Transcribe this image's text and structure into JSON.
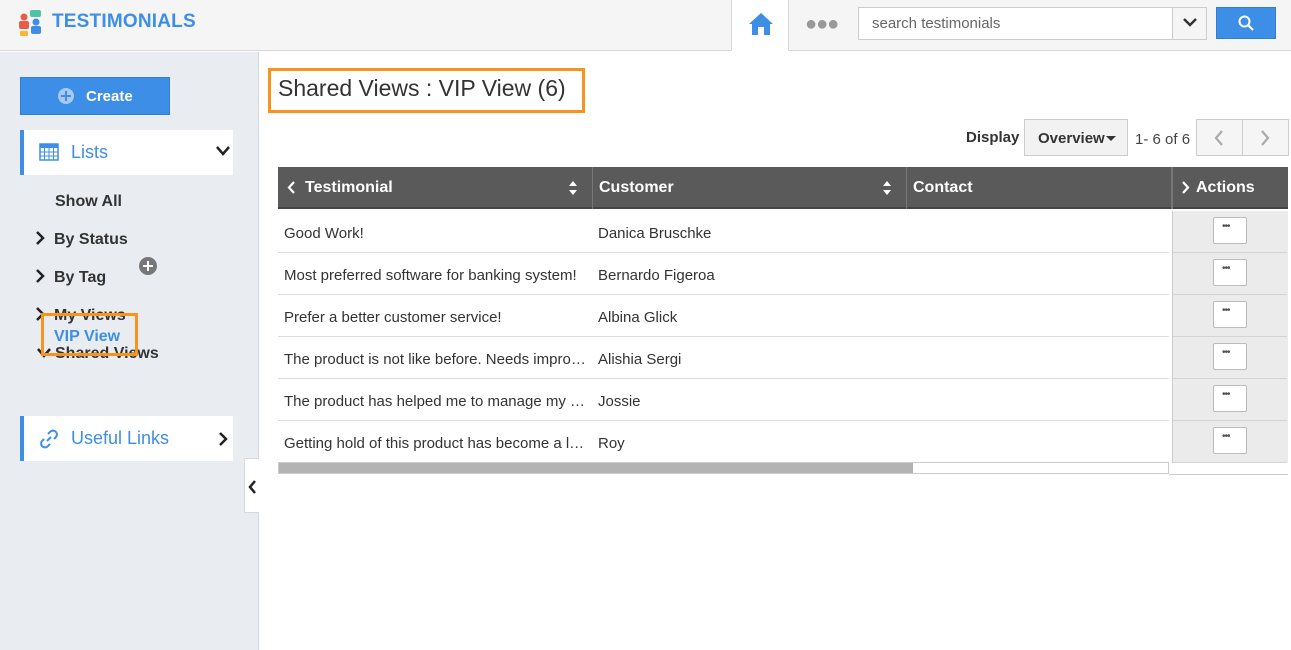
{
  "app": {
    "title": "TESTIMONIALS",
    "brand_color": "#3d8ee6",
    "highlight_color": "#f7941d"
  },
  "topbar": {
    "home_icon": "home-icon",
    "more_icon": "more-dots-icon",
    "search": {
      "placeholder": "search testimonials",
      "value": ""
    }
  },
  "sidebar": {
    "create_label": "Create",
    "lists_label": "Lists",
    "show_all": "Show All",
    "by_status": "By Status",
    "by_tag": "By Tag",
    "my_views": "My Views",
    "shared_views": "Shared Views",
    "vip_view": "VIP View",
    "useful_links": "Useful Links"
  },
  "main": {
    "heading": "Shared Views : VIP View (6)",
    "display_label": "Display",
    "display_value": "Overview",
    "page_info": "1- 6 of 6"
  },
  "table": {
    "columns": [
      "Testimonial",
      "Customer",
      "Contact",
      "Actions"
    ],
    "rows": [
      {
        "testimonial": "Good Work!",
        "customer": "Danica Bruschke",
        "contact": ""
      },
      {
        "testimonial": "Most preferred software for banking system!",
        "customer": "Bernardo Figeroa",
        "contact": ""
      },
      {
        "testimonial": "Prefer a better customer service!",
        "customer": "Albina Glick",
        "contact": ""
      },
      {
        "testimonial": "The product is not like before. Needs improvement.",
        "customer": "Alishia Sergi",
        "contact": ""
      },
      {
        "testimonial": "The product has helped me to manage my work.",
        "customer": "Jossie",
        "contact": ""
      },
      {
        "testimonial": "Getting hold of this product has become a little difficult.",
        "customer": "Roy",
        "contact": ""
      }
    ]
  }
}
